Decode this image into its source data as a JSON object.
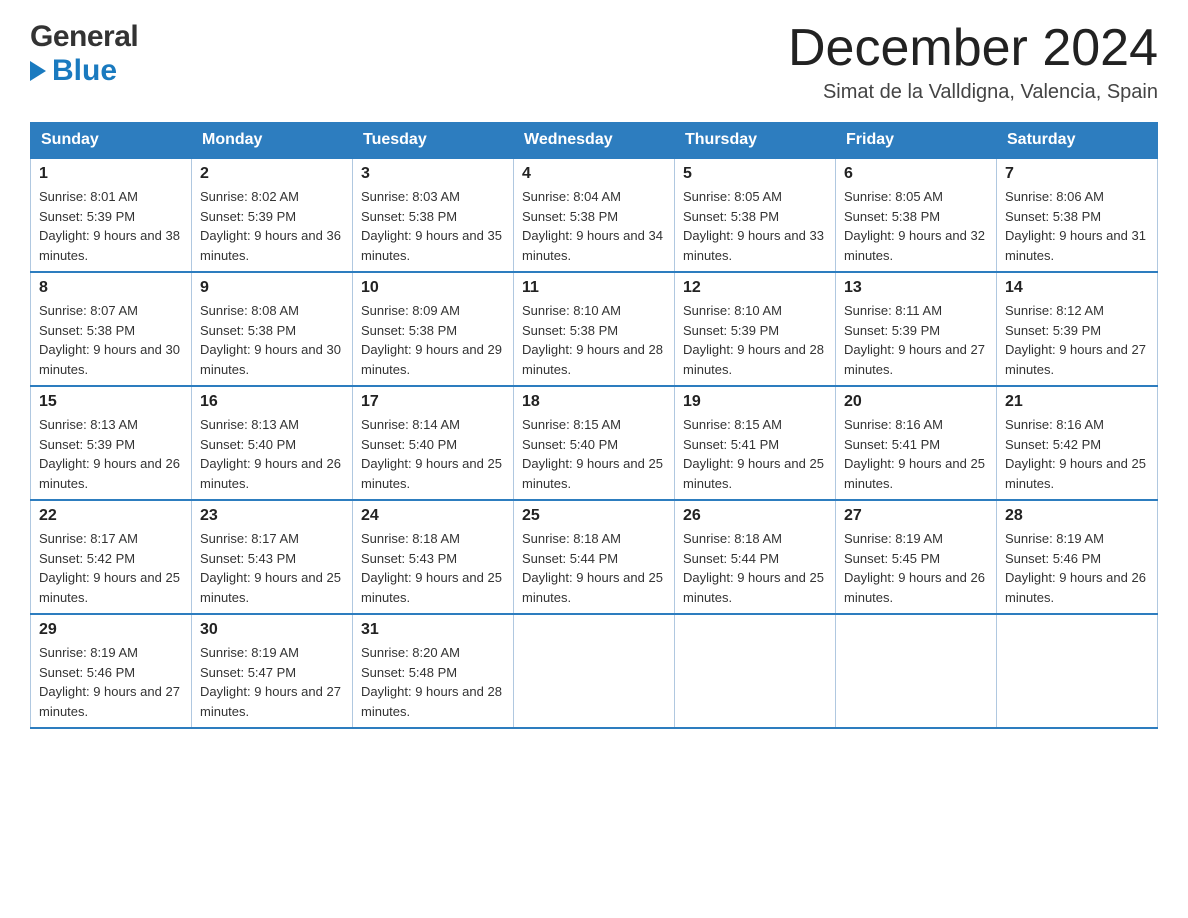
{
  "header": {
    "logo_general": "General",
    "logo_blue": "Blue",
    "month_title": "December 2024",
    "location": "Simat de la Valldigna, Valencia, Spain"
  },
  "calendar": {
    "days_of_week": [
      "Sunday",
      "Monday",
      "Tuesday",
      "Wednesday",
      "Thursday",
      "Friday",
      "Saturday"
    ],
    "weeks": [
      [
        {
          "day": "1",
          "sunrise": "8:01 AM",
          "sunset": "5:39 PM",
          "daylight": "9 hours and 38 minutes."
        },
        {
          "day": "2",
          "sunrise": "8:02 AM",
          "sunset": "5:39 PM",
          "daylight": "9 hours and 36 minutes."
        },
        {
          "day": "3",
          "sunrise": "8:03 AM",
          "sunset": "5:38 PM",
          "daylight": "9 hours and 35 minutes."
        },
        {
          "day": "4",
          "sunrise": "8:04 AM",
          "sunset": "5:38 PM",
          "daylight": "9 hours and 34 minutes."
        },
        {
          "day": "5",
          "sunrise": "8:05 AM",
          "sunset": "5:38 PM",
          "daylight": "9 hours and 33 minutes."
        },
        {
          "day": "6",
          "sunrise": "8:05 AM",
          "sunset": "5:38 PM",
          "daylight": "9 hours and 32 minutes."
        },
        {
          "day": "7",
          "sunrise": "8:06 AM",
          "sunset": "5:38 PM",
          "daylight": "9 hours and 31 minutes."
        }
      ],
      [
        {
          "day": "8",
          "sunrise": "8:07 AM",
          "sunset": "5:38 PM",
          "daylight": "9 hours and 30 minutes."
        },
        {
          "day": "9",
          "sunrise": "8:08 AM",
          "sunset": "5:38 PM",
          "daylight": "9 hours and 30 minutes."
        },
        {
          "day": "10",
          "sunrise": "8:09 AM",
          "sunset": "5:38 PM",
          "daylight": "9 hours and 29 minutes."
        },
        {
          "day": "11",
          "sunrise": "8:10 AM",
          "sunset": "5:38 PM",
          "daylight": "9 hours and 28 minutes."
        },
        {
          "day": "12",
          "sunrise": "8:10 AM",
          "sunset": "5:39 PM",
          "daylight": "9 hours and 28 minutes."
        },
        {
          "day": "13",
          "sunrise": "8:11 AM",
          "sunset": "5:39 PM",
          "daylight": "9 hours and 27 minutes."
        },
        {
          "day": "14",
          "sunrise": "8:12 AM",
          "sunset": "5:39 PM",
          "daylight": "9 hours and 27 minutes."
        }
      ],
      [
        {
          "day": "15",
          "sunrise": "8:13 AM",
          "sunset": "5:39 PM",
          "daylight": "9 hours and 26 minutes."
        },
        {
          "day": "16",
          "sunrise": "8:13 AM",
          "sunset": "5:40 PM",
          "daylight": "9 hours and 26 minutes."
        },
        {
          "day": "17",
          "sunrise": "8:14 AM",
          "sunset": "5:40 PM",
          "daylight": "9 hours and 25 minutes."
        },
        {
          "day": "18",
          "sunrise": "8:15 AM",
          "sunset": "5:40 PM",
          "daylight": "9 hours and 25 minutes."
        },
        {
          "day": "19",
          "sunrise": "8:15 AM",
          "sunset": "5:41 PM",
          "daylight": "9 hours and 25 minutes."
        },
        {
          "day": "20",
          "sunrise": "8:16 AM",
          "sunset": "5:41 PM",
          "daylight": "9 hours and 25 minutes."
        },
        {
          "day": "21",
          "sunrise": "8:16 AM",
          "sunset": "5:42 PM",
          "daylight": "9 hours and 25 minutes."
        }
      ],
      [
        {
          "day": "22",
          "sunrise": "8:17 AM",
          "sunset": "5:42 PM",
          "daylight": "9 hours and 25 minutes."
        },
        {
          "day": "23",
          "sunrise": "8:17 AM",
          "sunset": "5:43 PM",
          "daylight": "9 hours and 25 minutes."
        },
        {
          "day": "24",
          "sunrise": "8:18 AM",
          "sunset": "5:43 PM",
          "daylight": "9 hours and 25 minutes."
        },
        {
          "day": "25",
          "sunrise": "8:18 AM",
          "sunset": "5:44 PM",
          "daylight": "9 hours and 25 minutes."
        },
        {
          "day": "26",
          "sunrise": "8:18 AM",
          "sunset": "5:44 PM",
          "daylight": "9 hours and 25 minutes."
        },
        {
          "day": "27",
          "sunrise": "8:19 AM",
          "sunset": "5:45 PM",
          "daylight": "9 hours and 26 minutes."
        },
        {
          "day": "28",
          "sunrise": "8:19 AM",
          "sunset": "5:46 PM",
          "daylight": "9 hours and 26 minutes."
        }
      ],
      [
        {
          "day": "29",
          "sunrise": "8:19 AM",
          "sunset": "5:46 PM",
          "daylight": "9 hours and 27 minutes."
        },
        {
          "day": "30",
          "sunrise": "8:19 AM",
          "sunset": "5:47 PM",
          "daylight": "9 hours and 27 minutes."
        },
        {
          "day": "31",
          "sunrise": "8:20 AM",
          "sunset": "5:48 PM",
          "daylight": "9 hours and 28 minutes."
        },
        null,
        null,
        null,
        null
      ]
    ]
  }
}
